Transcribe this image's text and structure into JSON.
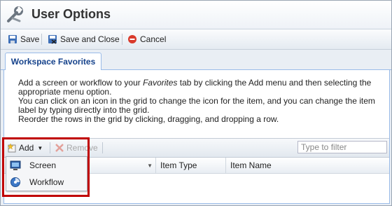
{
  "window": {
    "title": "User Options"
  },
  "toolbar": {
    "save_label": "Save",
    "save_close_label": "Save and Close",
    "cancel_label": "Cancel"
  },
  "tabs": [
    {
      "label": "Workspace Favorites",
      "active": true
    }
  ],
  "description": {
    "line1_pre": "Add a screen or workflow to your ",
    "line1_em": "Favorites",
    "line1_post": " tab by clicking the Add menu and then selecting the appropriate menu option.",
    "line2": "You can click on an icon in the grid to change the icon for the item, and you can change the item label by typing directly into the grid.",
    "line3": "Reorder the rows in the grid by clicking, dragging, and dropping a row."
  },
  "grid_toolbar": {
    "add_label": "Add",
    "remove_label": "Remove",
    "filter_placeholder": "Type to filter"
  },
  "grid": {
    "columns": [
      "",
      "Item Type",
      "Item Name"
    ]
  },
  "add_menu": {
    "items": [
      {
        "label": "Screen",
        "icon": "screen-icon"
      },
      {
        "label": "Workflow",
        "icon": "workflow-icon"
      }
    ]
  },
  "colors": {
    "accent": "#15428b",
    "highlight": "#c00000",
    "panel_border": "#99bbe8"
  }
}
